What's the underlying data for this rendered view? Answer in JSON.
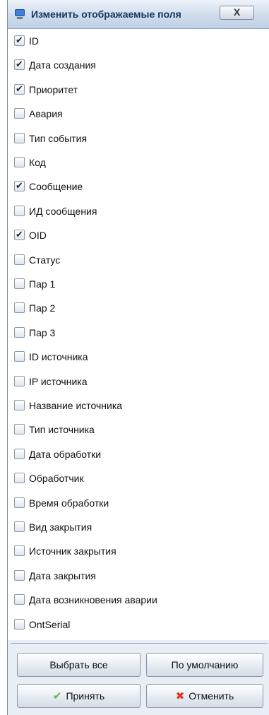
{
  "window": {
    "title": "Изменить отображаемые поля",
    "close_label": "X"
  },
  "fields": [
    {
      "label": "ID",
      "checked": true
    },
    {
      "label": "Дата создания",
      "checked": true
    },
    {
      "label": "Приоритет",
      "checked": true
    },
    {
      "label": "Авария",
      "checked": false
    },
    {
      "label": "Тип события",
      "checked": false
    },
    {
      "label": "Код",
      "checked": false
    },
    {
      "label": "Сообщение",
      "checked": true
    },
    {
      "label": "ИД сообщения",
      "checked": false
    },
    {
      "label": "OID",
      "checked": true
    },
    {
      "label": "Статус",
      "checked": false
    },
    {
      "label": "Пар 1",
      "checked": false
    },
    {
      "label": "Пар 2",
      "checked": false
    },
    {
      "label": "Пар 3",
      "checked": false
    },
    {
      "label": "ID источника",
      "checked": false
    },
    {
      "label": "IP источника",
      "checked": false
    },
    {
      "label": "Название источника",
      "checked": false
    },
    {
      "label": "Тип источника",
      "checked": false
    },
    {
      "label": "Дата обработки",
      "checked": false
    },
    {
      "label": "Обработчик",
      "checked": false
    },
    {
      "label": "Время обработки",
      "checked": false
    },
    {
      "label": "Вид закрытия",
      "checked": false
    },
    {
      "label": "Источник закрытия",
      "checked": false
    },
    {
      "label": "Дата закрытия",
      "checked": false
    },
    {
      "label": "Дата возникновения аварии",
      "checked": false
    },
    {
      "label": "OntSerial",
      "checked": false
    }
  ],
  "buttons": {
    "select_all": "Выбрать все",
    "default": "По умолчанию",
    "accept": "Принять",
    "cancel": "Отменить"
  },
  "icons": {
    "accept": "checkmark-icon",
    "cancel": "cross-icon",
    "app": "monitor-icon"
  }
}
